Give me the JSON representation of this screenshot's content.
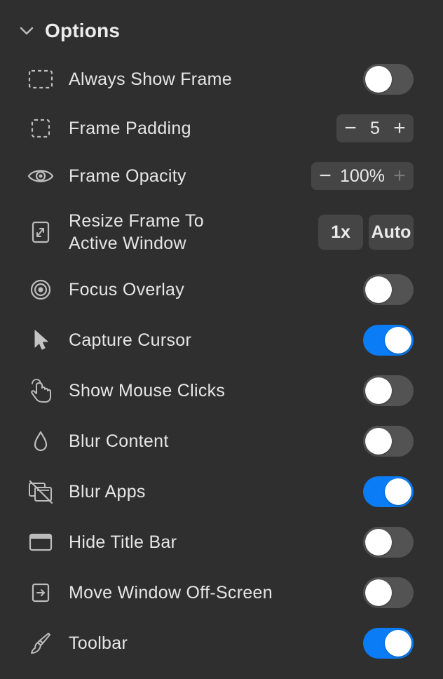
{
  "section": {
    "title": "Options",
    "collapse_icon": "chevron-down-icon"
  },
  "colors": {
    "background": "#2f2f2f",
    "toggle_on": "#0a7cf5",
    "toggle_off": "#535353",
    "control_bg": "#454545"
  },
  "options": {
    "always_show_frame": {
      "label": "Always Show Frame",
      "icon": "dashed-frame-icon",
      "enabled": false
    },
    "frame_padding": {
      "label": "Frame Padding",
      "icon": "dashed-square-icon",
      "value": "5",
      "decrement": "−",
      "increment": "+"
    },
    "frame_opacity": {
      "label": "Frame Opacity",
      "icon": "eye-icon",
      "value": "100%",
      "decrement": "−",
      "increment": "+"
    },
    "resize_frame": {
      "label_line1": "Resize Frame To",
      "label_line2": "Active Window",
      "icon": "resize-icon",
      "btn_1x": "1x",
      "btn_auto": "Auto"
    },
    "focus_overlay": {
      "label": "Focus Overlay",
      "icon": "target-icon",
      "enabled": false
    },
    "capture_cursor": {
      "label": "Capture Cursor",
      "icon": "cursor-arrow-icon",
      "enabled": true
    },
    "show_mouse_clicks": {
      "label": "Show Mouse Clicks",
      "icon": "pointing-hand-icon",
      "enabled": false
    },
    "blur_content": {
      "label": "Blur Content",
      "icon": "drop-icon",
      "enabled": false
    },
    "blur_apps": {
      "label": "Blur Apps",
      "icon": "windows-slash-icon",
      "enabled": true
    },
    "hide_title_bar": {
      "label": "Hide Title Bar",
      "icon": "window-icon",
      "enabled": false
    },
    "move_window_offscreen": {
      "label": "Move Window Off-Screen",
      "icon": "arrow-into-box-icon",
      "enabled": false
    },
    "toolbar": {
      "label": "Toolbar",
      "icon": "paintbrush-icon",
      "enabled": true
    }
  }
}
